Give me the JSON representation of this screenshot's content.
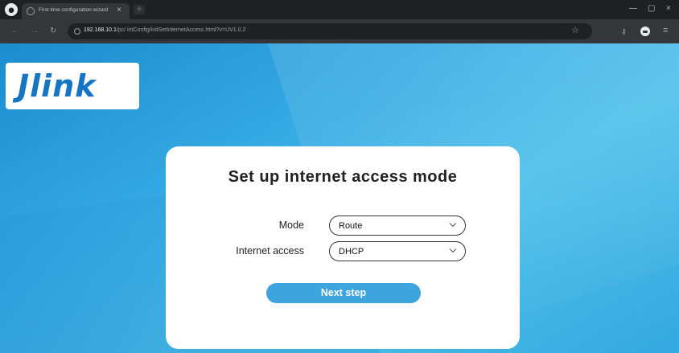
{
  "browser": {
    "tab_title": "First time configuration wizard",
    "tab_close": "×",
    "new_tab": "+",
    "url_host": "192.168.10.1",
    "url_path": "/pc/ intConfig/initSetInternetAccess.html?v=UV1.0.2",
    "window_controls": {
      "minimize": "—",
      "maximize": "▢",
      "close": "×"
    },
    "nav": {
      "back": "←",
      "forward": "→",
      "reload": "↻"
    },
    "toolbar_icons": {
      "key": "⚷",
      "star": "☆",
      "menu": "≡"
    }
  },
  "logo": {
    "text": "Jlink"
  },
  "setup": {
    "title": "Set up internet access mode",
    "mode_label": "Mode",
    "mode_value": "Route",
    "internet_access_label": "Internet access",
    "internet_access_value": "DHCP",
    "next_button": "Next step"
  },
  "colors": {
    "brand_blue": "#1674c4",
    "button_blue": "#3da4dd",
    "background_blue": "#35a9e3"
  },
  "icons": [
    "browser-logo-icon",
    "tab-favicon-icon",
    "lock-icon",
    "key-icon",
    "star-icon",
    "profile-icon",
    "menu-icon",
    "chevron-down-icon"
  ]
}
